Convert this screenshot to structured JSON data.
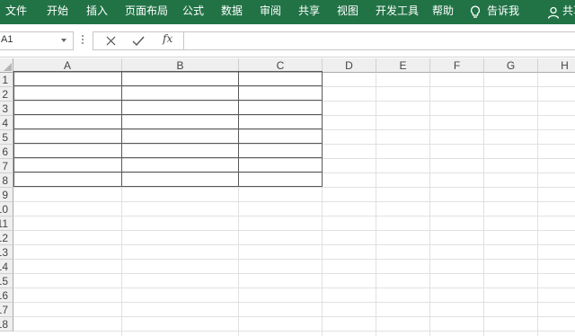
{
  "ribbon": {
    "tabs": [
      "文件",
      "开始",
      "插入",
      "页面布局",
      "公式",
      "数据",
      "审阅",
      "共享",
      "视图",
      "开发工具",
      "帮助"
    ],
    "tell_me": "告诉我",
    "share": "共享",
    "background": "#217346"
  },
  "formula_bar": {
    "name_box": "A1",
    "cancel_icon": "x-icon",
    "enter_icon": "check-icon",
    "function_label": "fx",
    "formula_value": ""
  },
  "sheet": {
    "columns": [
      "A",
      "B",
      "C",
      "D",
      "E",
      "F",
      "G",
      "H"
    ],
    "rows": [
      "1",
      "2",
      "3",
      "4",
      "5",
      "6",
      "7",
      "8",
      "9",
      "10",
      "11",
      "12",
      "13",
      "14",
      "15",
      "16",
      "17",
      "18"
    ],
    "bordered_range": "A1:C8",
    "border_color": "#595959"
  }
}
